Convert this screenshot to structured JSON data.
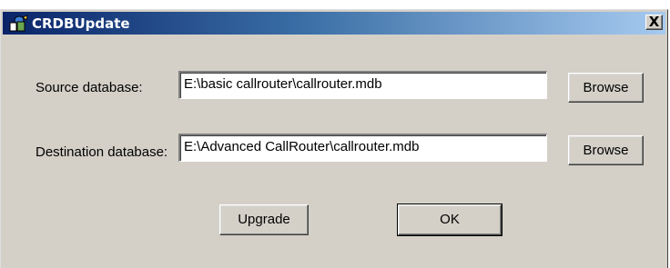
{
  "window": {
    "title": "CRDBUpdate",
    "close_glyph": "X",
    "icon": "app-icon"
  },
  "source": {
    "label": "Source database:",
    "value": "E:\\basic callrouter\\callrouter.mdb",
    "browse_label": "Browse"
  },
  "destination": {
    "label": "Destination database:",
    "value": "E:\\Advanced CallRouter\\callrouter.mdb",
    "browse_label": "Browse"
  },
  "actions": {
    "upgrade_label": "Upgrade",
    "ok_label": "OK"
  },
  "colors": {
    "title_start": "#0a246a",
    "title_end": "#a6caf0",
    "face": "#d4d0c8"
  }
}
